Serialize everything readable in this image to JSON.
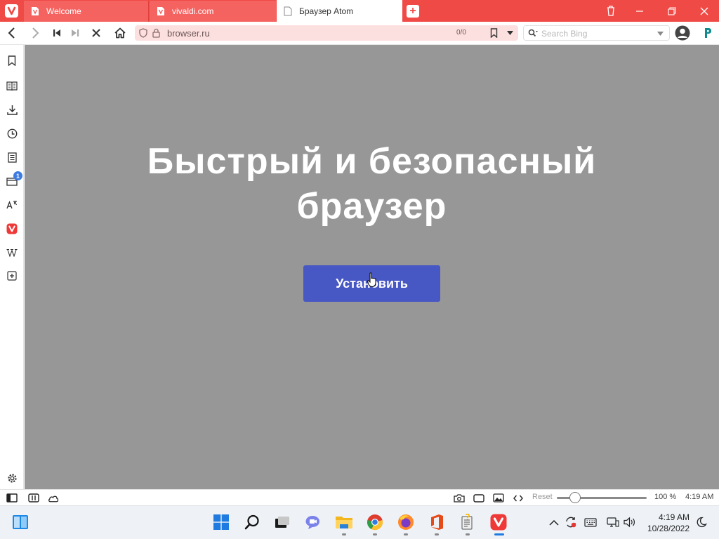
{
  "browser": {
    "tabs": [
      {
        "title": "Welcome",
        "icon": "vivaldi-page-icon",
        "active": false
      },
      {
        "title": "vivaldi.com",
        "icon": "vivaldi-page-icon",
        "active": false
      },
      {
        "title": "Браузер Atom",
        "icon": "document-icon",
        "active": true
      }
    ],
    "url": "browser.ru",
    "find_counter": "0/0",
    "search_placeholder": "Search Bing",
    "accent_color": "#f04a46"
  },
  "sidepanel": {
    "items": [
      "bookmark-icon",
      "reader-icon",
      "download-icon",
      "history-icon",
      "notes-icon",
      "window-icon",
      "translate-icon",
      "vivaldi-icon",
      "wikipedia-icon",
      "add-panel-icon"
    ],
    "badge": "1"
  },
  "page": {
    "headline_line1": "Быстрый и безопасный",
    "headline_line2": "браузер",
    "install_button": "Установить",
    "background_color": "#979797",
    "button_color": "#4757c4"
  },
  "statusbar": {
    "reset_label": "Reset",
    "zoom": "100 %",
    "zoom_level": 0.2,
    "time": "4:19 AM"
  },
  "taskbar": {
    "time": "4:19 AM",
    "date": "10/28/2022",
    "apps": [
      "windows-start-icon",
      "search-icon",
      "task-view-icon",
      "teams-chat-icon",
      "file-explorer-icon",
      "chrome-icon",
      "firefox-icon",
      "office-icon",
      "notepad-icon",
      "vivaldi-icon"
    ]
  }
}
